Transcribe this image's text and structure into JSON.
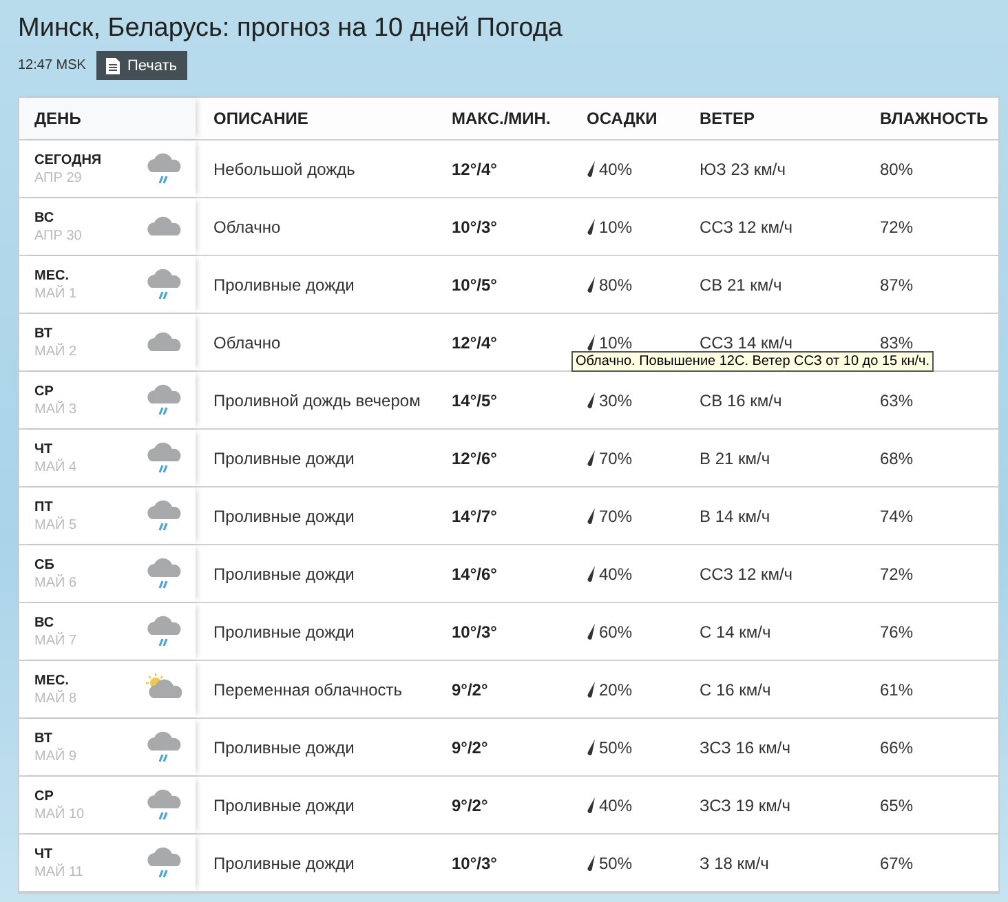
{
  "page": {
    "title": "Минск, Беларусь: прогноз на 10 дней Погода",
    "time": "12:47 MSK",
    "print_button": "Печать"
  },
  "table": {
    "columns": [
      "ДЕНЬ",
      "ОПИСАНИЕ",
      "МАКС./МИН.",
      "ОСАДКИ",
      "ВЕТЕР",
      "ВЛАЖНОСТЬ"
    ],
    "rows": [
      {
        "day": "СЕГОДНЯ",
        "date": "АПР 29",
        "kind": "rain",
        "description": "Небольшой дождь",
        "temp": "12°/4°",
        "precip": "40%",
        "wind": "ЮЗ 23 км/ч",
        "humidity": "80%"
      },
      {
        "day": "ВС",
        "date": "АПР 30",
        "kind": "cloud",
        "description": "Облачно",
        "temp": "10°/3°",
        "precip": "10%",
        "wind": "ССЗ 12 км/ч",
        "humidity": "72%"
      },
      {
        "day": "МЕС.",
        "date": "МАЙ 1",
        "kind": "rain",
        "description": "Проливные дожди",
        "temp": "10°/5°",
        "precip": "80%",
        "wind": "СВ 21 км/ч",
        "humidity": "87%"
      },
      {
        "day": "ВТ",
        "date": "МАЙ 2",
        "kind": "cloud",
        "description": "Облачно",
        "temp": "12°/4°",
        "precip": "10%",
        "wind": "ССЗ 14 км/ч",
        "humidity": "83%",
        "tooltip": "Облачно. Повышение 12C. Ветер ССЗ от 10 до 15 кн/ч."
      },
      {
        "day": "СР",
        "date": "МАЙ 3",
        "kind": "rain",
        "description": "Проливной дождь вечером",
        "temp": "14°/5°",
        "precip": "30%",
        "wind": "СВ 16 км/ч",
        "humidity": "63%"
      },
      {
        "day": "ЧТ",
        "date": "МАЙ 4",
        "kind": "rain",
        "description": "Проливные дожди",
        "temp": "12°/6°",
        "precip": "70%",
        "wind": "В 21 км/ч",
        "humidity": "68%"
      },
      {
        "day": "ПТ",
        "date": "МАЙ 5",
        "kind": "rain",
        "description": "Проливные дожди",
        "temp": "14°/7°",
        "precip": "70%",
        "wind": "В 14 км/ч",
        "humidity": "74%"
      },
      {
        "day": "СБ",
        "date": "МАЙ 6",
        "kind": "rain",
        "description": "Проливные дожди",
        "temp": "14°/6°",
        "precip": "40%",
        "wind": "ССЗ 12 км/ч",
        "humidity": "72%"
      },
      {
        "day": "ВС",
        "date": "МАЙ 7",
        "kind": "rain",
        "description": "Проливные дожди",
        "temp": "10°/3°",
        "precip": "60%",
        "wind": "С 14 км/ч",
        "humidity": "76%"
      },
      {
        "day": "МЕС.",
        "date": "МАЙ 8",
        "kind": "partly",
        "description": "Переменная облачность",
        "temp": "9°/2°",
        "precip": "20%",
        "wind": "С 16 км/ч",
        "humidity": "61%"
      },
      {
        "day": "ВТ",
        "date": "МАЙ 9",
        "kind": "rain",
        "description": "Проливные дожди",
        "temp": "9°/2°",
        "precip": "50%",
        "wind": "ЗСЗ 16 км/ч",
        "humidity": "66%"
      },
      {
        "day": "СР",
        "date": "МАЙ 10",
        "kind": "rain",
        "description": "Проливные дожди",
        "temp": "9°/2°",
        "precip": "40%",
        "wind": "ЗСЗ 19 км/ч",
        "humidity": "65%"
      },
      {
        "day": "ЧТ",
        "date": "МАЙ 11",
        "kind": "rain",
        "description": "Проливные дожди",
        "temp": "10°/3°",
        "precip": "50%",
        "wind": "З 18 км/ч",
        "humidity": "67%"
      }
    ]
  }
}
